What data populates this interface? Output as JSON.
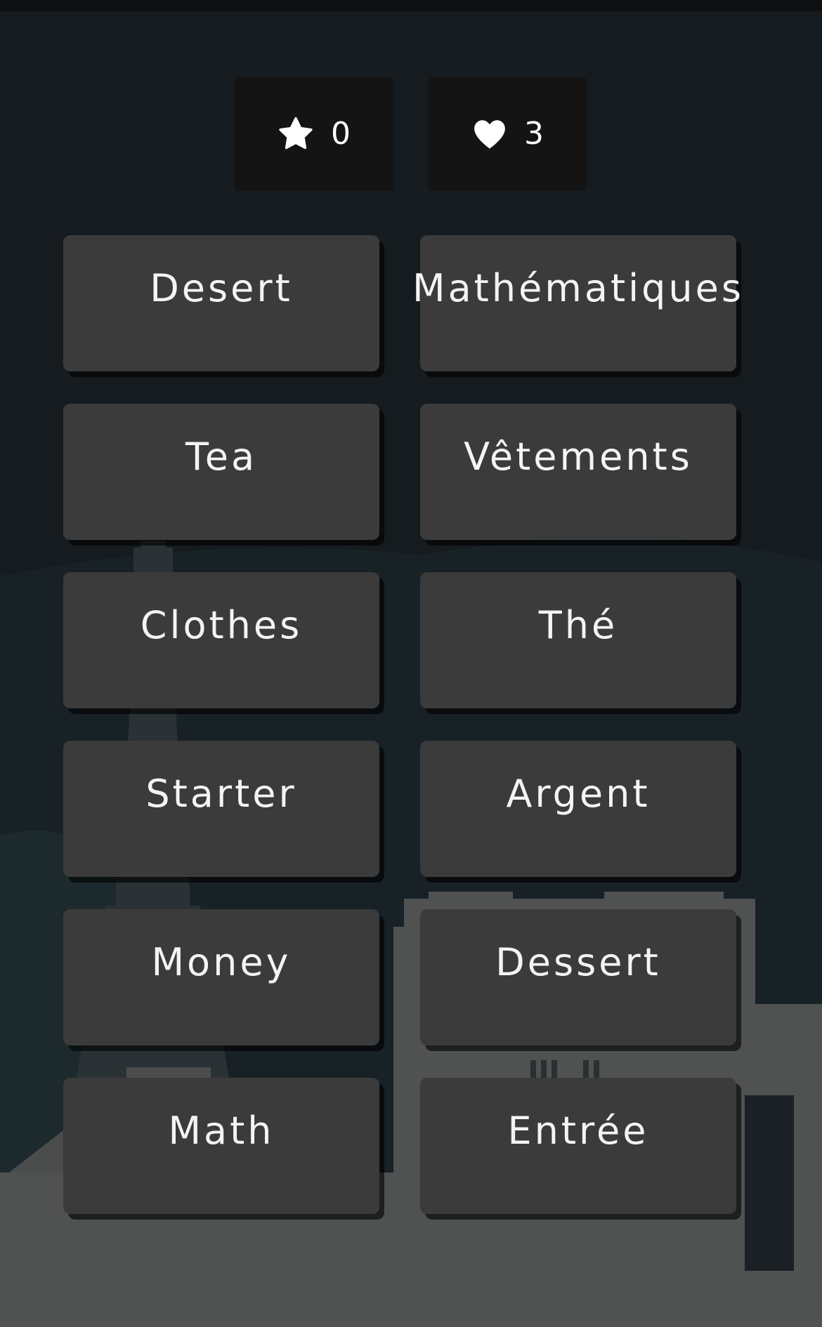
{
  "hud": {
    "stars_icon": "star-icon",
    "stars_value": "0",
    "lives_icon": "heart-icon",
    "lives_value": "3"
  },
  "grid": {
    "cards": [
      {
        "label": "Desert"
      },
      {
        "label": "Mathématiques"
      },
      {
        "label": "Tea"
      },
      {
        "label": "Vêtements"
      },
      {
        "label": "Clothes"
      },
      {
        "label": "Thé"
      },
      {
        "label": "Starter"
      },
      {
        "label": "Argent"
      },
      {
        "label": "Money"
      },
      {
        "label": "Dessert"
      },
      {
        "label": "Math"
      },
      {
        "label": "Entrée"
      }
    ]
  },
  "colors": {
    "background": "#151b1f",
    "card": "#3b3b3b",
    "hud_box": "#141414",
    "skyline": "#505252"
  }
}
